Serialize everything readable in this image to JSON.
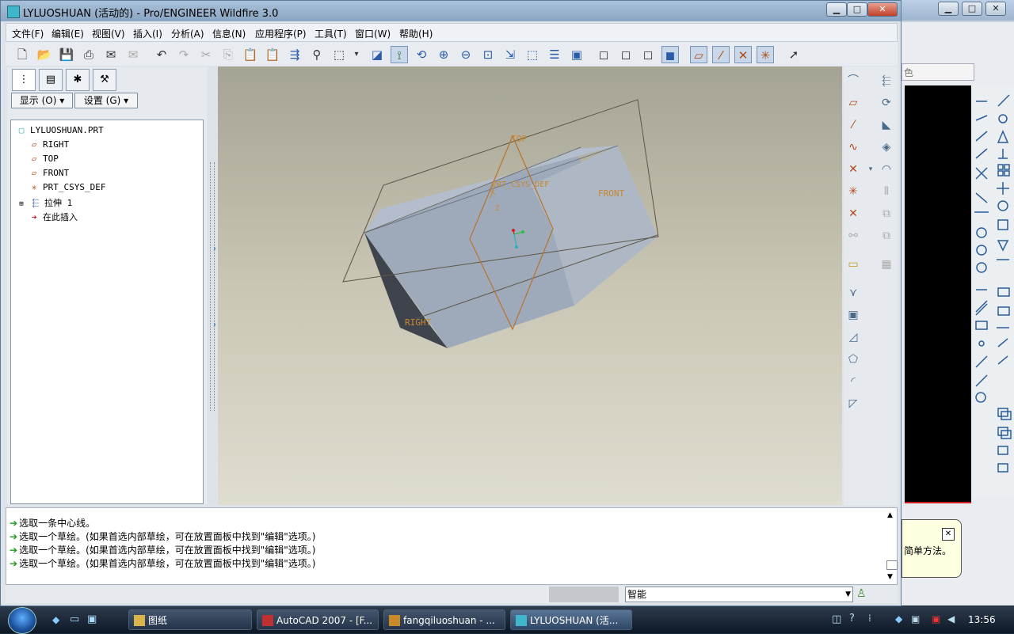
{
  "window": {
    "title": "LYLUOSHUAN (活动的) - Pro/ENGINEER Wildfire 3.0",
    "minimize": "▁",
    "maximize": "□",
    "close": "✕"
  },
  "menu": [
    "文件(F)",
    "编辑(E)",
    "视图(V)",
    "插入(I)",
    "分析(A)",
    "信息(N)",
    "应用程序(P)",
    "工具(T)",
    "窗口(W)",
    "帮助(H)"
  ],
  "left_panel": {
    "show_button": "显示 (O) ▾",
    "settings_button": "设置 (G) ▾",
    "tree": [
      {
        "label": "LYLUOSHUAN.PRT",
        "icon": "part-icon"
      },
      {
        "label": "RIGHT",
        "icon": "datum-plane-icon"
      },
      {
        "label": "TOP",
        "icon": "datum-plane-icon"
      },
      {
        "label": "FRONT",
        "icon": "datum-plane-icon"
      },
      {
        "label": "PRT_CSYS_DEF",
        "icon": "csys-icon"
      },
      {
        "label": "拉伸 1",
        "icon": "extrude-icon"
      },
      {
        "label": "在此插入",
        "icon": "insert-here-icon"
      }
    ]
  },
  "viewport": {
    "labels": {
      "top": "TOP",
      "csys": "PRT_CSYS_DEF",
      "front": "FRONT",
      "right": "RIGHT",
      "z": "Z"
    }
  },
  "messages": [
    "选取一条中心线。",
    "选取一个草绘。(如果首选内部草绘，可在放置面板中找到\"编辑\"选项。)",
    "选取一个草绘。(如果首选内部草绘，可在放置面板中找到\"编辑\"选项。)",
    "选取一个草绘。(如果首选内部草绘，可在放置面板中找到\"编辑\"选项。)"
  ],
  "status": {
    "filter_value": "智能"
  },
  "background_window": {
    "combo_text": "色",
    "balloon_text": "简单方法。"
  },
  "taskbar": {
    "tasks": [
      {
        "label": "图纸",
        "active": false
      },
      {
        "label": "AutoCAD 2007 - [F...",
        "active": false
      },
      {
        "label": "fangqiluoshuan - ...",
        "active": false
      },
      {
        "label": "LYLUOSHUAN (活...",
        "active": true
      }
    ],
    "clock": "13:56"
  }
}
